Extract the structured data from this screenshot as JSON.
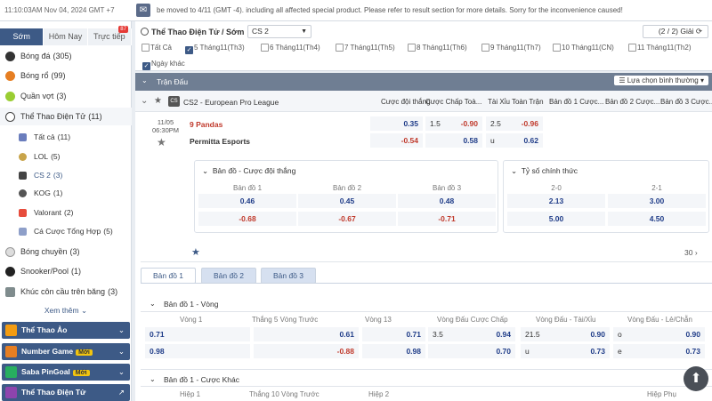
{
  "topbar": {
    "time": "11:10:03AM Nov 04, 2024 GMT +7",
    "message": "be moved to 4/11 (GMT -4). including all affected special product. Please refer to result section for more details. Sorry for the inconvenience caused!"
  },
  "sidebar": {
    "tabs": [
      {
        "label": "Sớm"
      },
      {
        "label": "Hôm Nay"
      },
      {
        "label": "Trực tiếp",
        "badge": "87"
      }
    ],
    "items": [
      {
        "label": "Bóng đá",
        "count": "(305)"
      },
      {
        "label": "Bóng rổ",
        "count": "(99)"
      },
      {
        "label": "Quần vợt",
        "count": "(3)"
      },
      {
        "label": "Thể Thao Điện Tử",
        "count": "(11)"
      }
    ],
    "esports": [
      {
        "label": "Tất cả",
        "count": "(11)"
      },
      {
        "label": "LOL",
        "count": "(5)"
      },
      {
        "label": "CS 2",
        "count": "(3)"
      },
      {
        "label": "KOG",
        "count": "(1)"
      },
      {
        "label": "Valorant",
        "count": "(2)"
      },
      {
        "label": "Cá Cược Tổng Hợp",
        "count": "(5)"
      }
    ],
    "items2": [
      {
        "label": "Bóng chuyền",
        "count": "(3)"
      },
      {
        "label": "Snooker/Pool",
        "count": "(1)"
      },
      {
        "label": "Khúc côn cầu trên băng",
        "count": "(3)"
      }
    ],
    "more": "Xem thêm",
    "promos": [
      {
        "label": "Thể Thao Ảo",
        "new": ""
      },
      {
        "label": "Number Game",
        "new": "Mới"
      },
      {
        "label": "Saba PinGoal",
        "new": "Mới"
      },
      {
        "label": "Thể Thao Điện Tử",
        "new": ""
      }
    ]
  },
  "header": {
    "title": "Thể Thao Điện Tử / Sớm",
    "select": "CS 2",
    "pager": "(2 / 2) Giải",
    "dates": [
      {
        "label": "Tất Cả",
        "checked": false
      },
      {
        "label": "5 Tháng11(Th3)",
        "checked": true
      },
      {
        "label": "6 Tháng11(Th4)",
        "checked": false
      },
      {
        "label": "7 Tháng11(Th5)",
        "checked": false
      },
      {
        "label": "8 Tháng11(Th6)",
        "checked": false
      },
      {
        "label": "9 Tháng11(Th7)",
        "checked": false
      },
      {
        "label": "10 Tháng11(CN)",
        "checked": false
      },
      {
        "label": "11 Tháng11(Th2)",
        "checked": false
      },
      {
        "label": "Ngày khác",
        "checked": true
      }
    ]
  },
  "section": {
    "title": "Trận Đấu",
    "sort": "Lựa chọn bình thường"
  },
  "league": {
    "name": "CS2 - European Pro League",
    "cols": [
      "Cược đội thắng",
      "Cược Chấp Toà...",
      "Tài Xỉu Toàn Trận",
      "Bản đồ 1 Cược...",
      "Bản đồ 2 Cược...",
      "Bản đồ 3 Cược..."
    ]
  },
  "match": {
    "date": "11/05",
    "time": "06:30PM",
    "team1": "9 Pandas",
    "team2": "Permitta Esports",
    "win": [
      "0.35",
      "-0.54"
    ],
    "hcp": {
      "line": "1.5",
      "odd1": "-0.90",
      "odd2": "0.58"
    },
    "ou": {
      "line": "2.5",
      "odd1": "-0.96",
      "u": "u",
      "odd2": "0.62"
    }
  },
  "panel1": {
    "title": "Bản đồ - Cược đội thắng",
    "cols": [
      "Bản đồ 1",
      "Bản đồ 2",
      "Bản đồ 3"
    ],
    "row1": [
      "0.46",
      "0.45",
      "0.48"
    ],
    "row2": [
      "-0.68",
      "-0.67",
      "-0.71"
    ]
  },
  "panel2": {
    "title": "Tỷ số chính thức",
    "cols": [
      "2-0",
      "2-1"
    ],
    "row1": [
      "2.13",
      "3.00"
    ],
    "row2": [
      "5.00",
      "4.50"
    ]
  },
  "morecount": "30",
  "maptabs": [
    "Bản đồ 1",
    "Bản đồ 2",
    "Bản đồ 3"
  ],
  "group1": {
    "title": "Bản đồ 1 - Vòng",
    "cols": [
      "Vòng 1",
      "Thắng 5 Vòng Trước",
      "Vòng 13",
      "Vòng Đấu Cược Chấp",
      "Vòng Đấu - Tài/Xỉu",
      "Vòng Đấu - Lẻ/Chẵn"
    ],
    "row1": [
      "0.71",
      "0.61",
      "0.71",
      "3.5",
      "0.94",
      "21.5",
      "0.90",
      "o",
      "0.90"
    ],
    "row2": [
      "0.98",
      "-0.88",
      "0.98",
      "",
      "0.70",
      "u",
      "0.73",
      "e",
      "0.73"
    ]
  },
  "group2": {
    "title": "Bản đồ 1 - Cược Khác",
    "cols": [
      "Hiệp 1",
      "Thắng 10 Vòng Trước",
      "Hiệp 2",
      "Hiệp Phụ"
    ]
  }
}
